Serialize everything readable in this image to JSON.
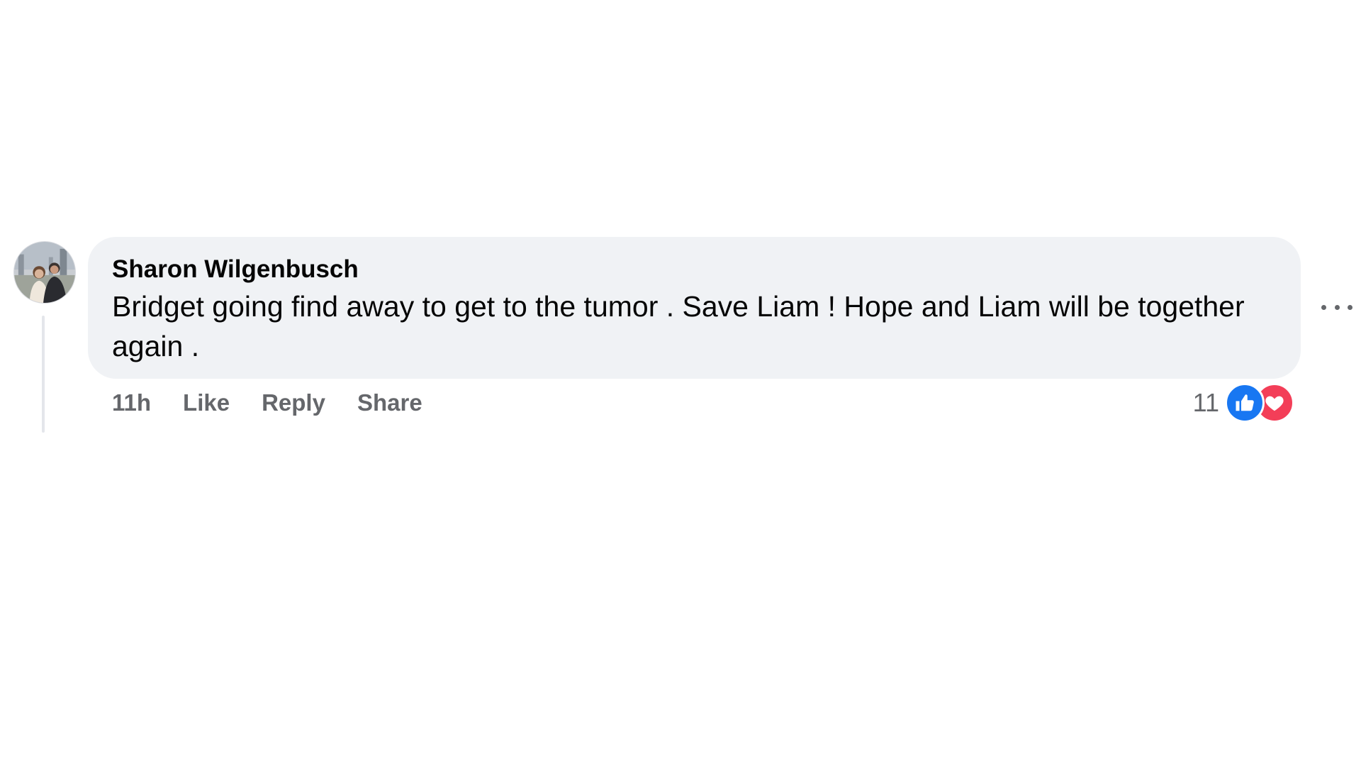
{
  "comment": {
    "author": "Sharon Wilgenbusch",
    "text": "Bridget going find away to get to the tumor . Save Liam ! Hope and Liam will be together again .",
    "timestamp": "11h",
    "actions": {
      "like": "Like",
      "reply": "Reply",
      "share": "Share"
    },
    "reactions": {
      "count": "11",
      "types": [
        "like-icon",
        "love-icon"
      ],
      "colors": {
        "like": "#1877f2",
        "love": "#f33e58"
      }
    }
  },
  "colors": {
    "bubble_background": "#f0f2f5",
    "secondary_text": "#65676b",
    "thread_line": "#e4e6eb"
  }
}
